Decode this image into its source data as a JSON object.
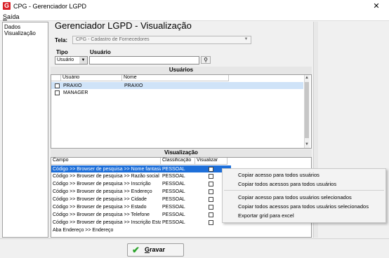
{
  "window": {
    "title": "CPG - Gerenciador LGPD",
    "icon_letter": "G",
    "close_glyph": "✕"
  },
  "menu": {
    "saida_first": "S",
    "saida_rest": "aída"
  },
  "tree": {
    "line1": "Dados",
    "line2": "Visualização"
  },
  "page": {
    "title": "Gerenciador LGPD - Visualização"
  },
  "tela": {
    "label": "Tela:",
    "value": "CPG - Cadastro de Fornecedores"
  },
  "filter": {
    "tipo_label": "Tipo",
    "tipo_value": "Usuário",
    "usuario_label": "Usuário",
    "usuario_value": ""
  },
  "users_panel": {
    "title": "Usuários",
    "headers": [
      "Usuário",
      "Nome"
    ],
    "rows": [
      {
        "usuario": "PRAXIO",
        "nome": "PRAXIO",
        "selected": true
      },
      {
        "usuario": "MANAGER",
        "nome": "",
        "selected": false
      }
    ]
  },
  "view_panel": {
    "title": "Visualização",
    "headers": [
      "Campo",
      "Classificação",
      "Visualizar"
    ],
    "rows": [
      {
        "campo": "Código >> Browser de pesquisa >> Nome fantasia",
        "classificacao": "PESSOAL",
        "selected": true
      },
      {
        "campo": "Código >> Browser de pesquisa >> Razão social",
        "classificacao": "PESSOAL",
        "selected": false
      },
      {
        "campo": "Código >> Browser de pesquisa >> Inscrição",
        "classificacao": "PESSOAL",
        "selected": false
      },
      {
        "campo": "Código >> Browser de pesquisa >> Endereço",
        "classificacao": "PESSOAL",
        "selected": false
      },
      {
        "campo": "Código >> Browser de pesquisa >> Cidade",
        "classificacao": "PESSOAL",
        "selected": false
      },
      {
        "campo": "Código >> Browser de pesquisa >> Estado",
        "classificacao": "PESSOAL",
        "selected": false
      },
      {
        "campo": "Código >> Browser de pesquisa >> Telefone",
        "classificacao": "PESSOAL",
        "selected": false
      },
      {
        "campo": "Código >> Browser de pesquisa >> Inscrição Esta...",
        "classificacao": "PESSOAL",
        "selected": false
      },
      {
        "campo": "Aba Endereço >> Endereço",
        "classificacao": "",
        "selected": false
      }
    ]
  },
  "context_menu": [
    "Copiar acesso para todos usuários",
    "Copiar todos acessos para todos usuários",
    "Copiar acesso para todos usuários selecionados",
    "Copiar todos acessos para todos usuários selecionados",
    "Exportar grid para excel"
  ],
  "save": {
    "first": "G",
    "rest": "ravar",
    "icon": "✔"
  },
  "colors": {
    "selection": "#1e6fd9",
    "light_selection": "#cfe3f8",
    "icon_red": "#d81f26",
    "check_green": "#2aa22a"
  }
}
